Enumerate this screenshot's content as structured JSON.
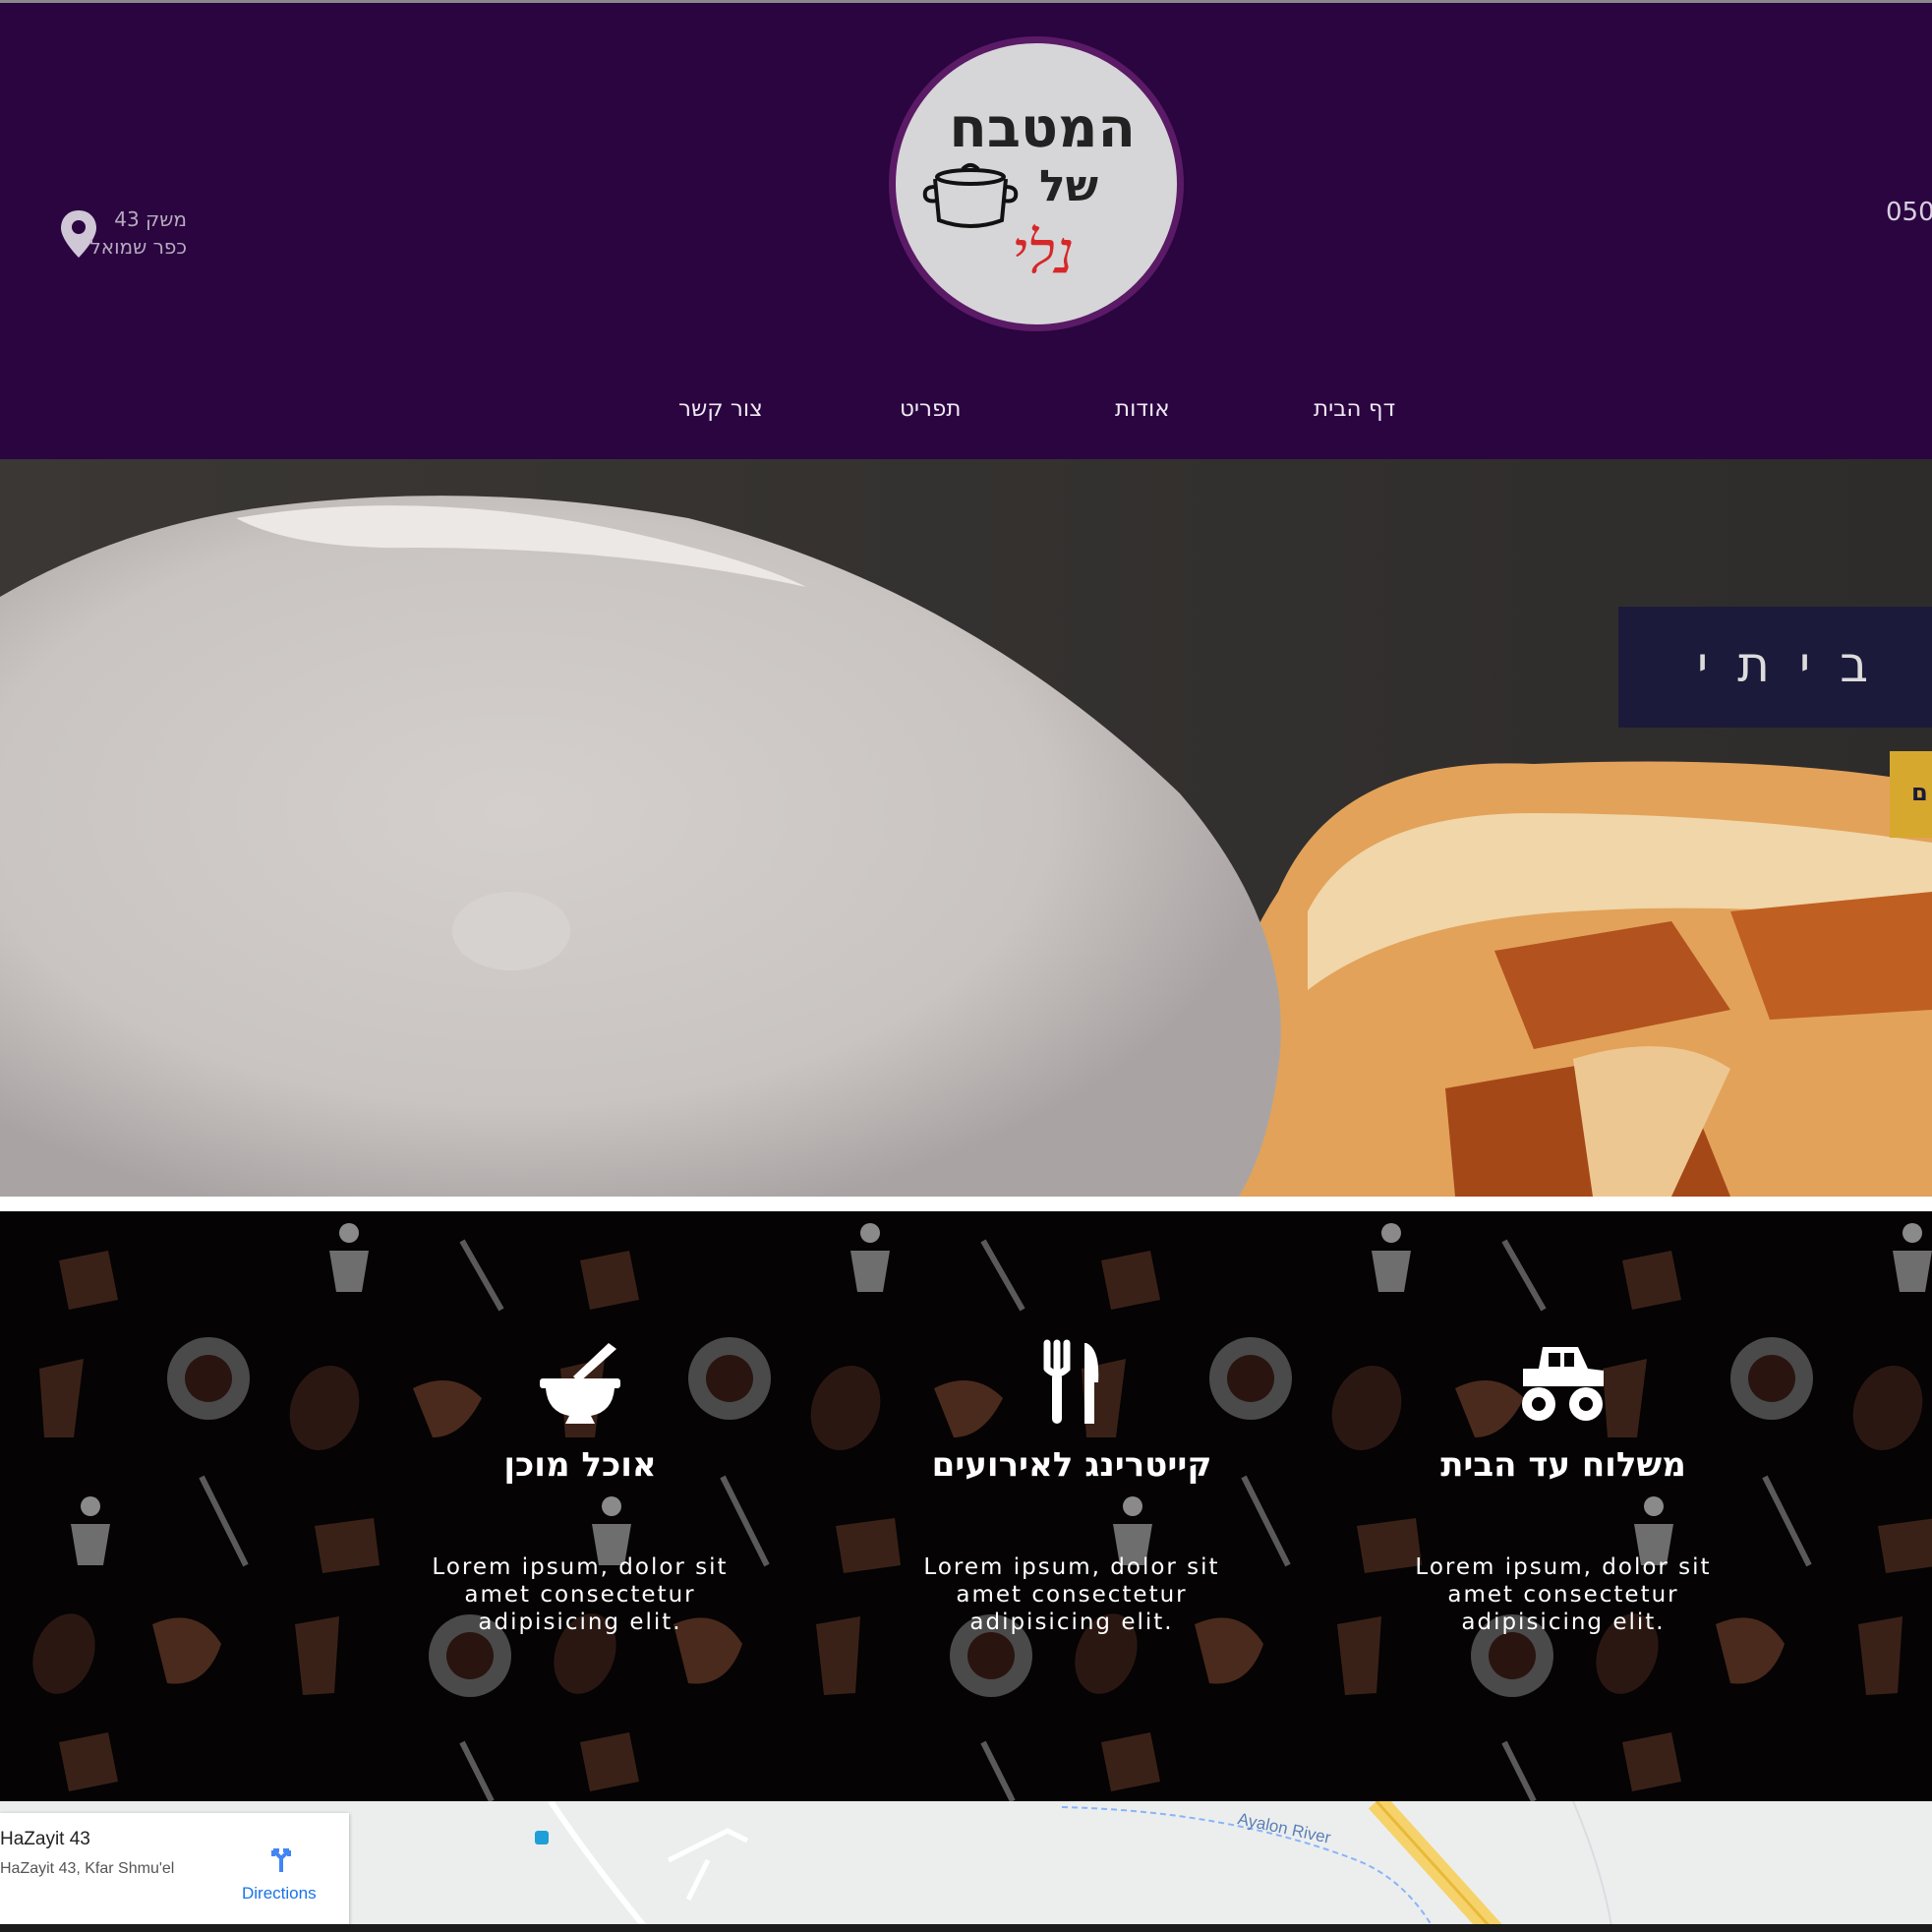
{
  "header": {
    "address_line1": "משק 43",
    "address_line2": "כפר שמואל",
    "phone": "050",
    "logo": {
      "line1": "המטבח",
      "line2": "של",
      "line3": "נלי"
    }
  },
  "nav": {
    "items": [
      {
        "label": "דף הבית"
      },
      {
        "label": "אודות"
      },
      {
        "label": "תפריט"
      },
      {
        "label": "צור קשר"
      }
    ]
  },
  "hero": {
    "tagline": "ל ביתי",
    "cta_label": "ם"
  },
  "services": [
    {
      "icon": "delivery-truck-icon",
      "title": "משלוח עד הבית",
      "text": "Lorem ipsum, dolor sit amet consectetur adipisicing elit."
    },
    {
      "icon": "utensils-icon",
      "title": "קייטרינג לאירועים",
      "text": "Lorem ipsum, dolor sit amet consectetur adipisicing elit."
    },
    {
      "icon": "mortar-pestle-icon",
      "title": "אוכל מוכן",
      "text": "Lorem ipsum, dolor sit amet consectetur adipisicing elit."
    }
  ],
  "map": {
    "place_name": "HaZayit 43",
    "place_address": "HaZayit 43, Kfar Shmu'el",
    "directions_label": "Directions",
    "river_label": "Ayalon River"
  },
  "colors": {
    "header_bg": "#2a0540",
    "tagline_bg": "#1b1a3a",
    "cta_bg": "#d7a82e",
    "services_bg": "#050304"
  }
}
